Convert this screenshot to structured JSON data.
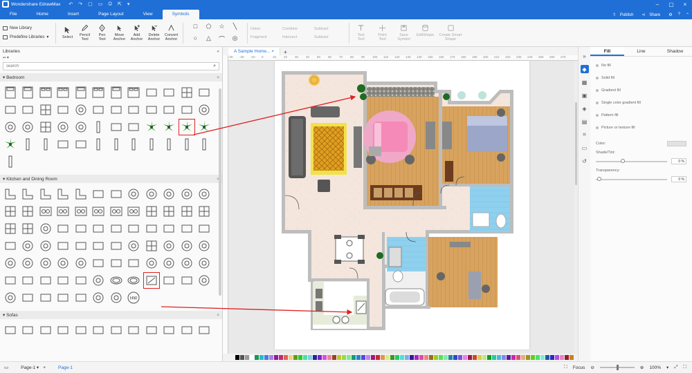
{
  "app": {
    "title": "Wondershare EdrawMax"
  },
  "menu": {
    "tabs": [
      "File",
      "Home",
      "Insert",
      "Page Layout",
      "View",
      "Symbols"
    ],
    "active": "Symbols",
    "publish": "Publish",
    "share": "Share",
    "user_initial": "1"
  },
  "ribbon": {
    "new_library": "New Library",
    "predefine_libraries": "Predefine Libraries",
    "tools": [
      {
        "line1": "Select",
        "line2": ""
      },
      {
        "line1": "Pencil",
        "line2": "Tool"
      },
      {
        "line1": "Pen",
        "line2": "Tool"
      },
      {
        "line1": "Move",
        "line2": "Anchor"
      },
      {
        "line1": "Add",
        "line2": "Anchor"
      },
      {
        "line1": "Delete",
        "line2": "Anchor"
      },
      {
        "line1": "Convert",
        "line2": "Anchor"
      }
    ],
    "boolean_ops": [
      "Union",
      "Combine",
      "Subtract",
      "Fragment",
      "Intersect",
      "Subtract"
    ],
    "grey_tools": [
      {
        "line1": "Text",
        "line2": "Tool"
      },
      {
        "line1": "Point",
        "line2": "Tool"
      },
      {
        "line1": "Save",
        "line2": "Symbol"
      },
      {
        "line1": "EditShape",
        "line2": ""
      },
      {
        "line1": "Create Smart",
        "line2": "Shape"
      }
    ]
  },
  "libraries": {
    "title": "Libraries",
    "search_placeholder": "search",
    "sections": [
      "Bedroom",
      "Kitchen and Dining Room",
      "Sofas"
    ],
    "hw_label": "HW"
  },
  "canvas": {
    "doc_tab": "A Sample Home...",
    "ruler_ticks": [
      "-30",
      "-20",
      "-10",
      "0",
      "10",
      "20",
      "30",
      "40",
      "50",
      "60",
      "70",
      "80",
      "90",
      "100",
      "110",
      "120",
      "130",
      "140",
      "150",
      "160",
      "170",
      "180",
      "190",
      "200",
      "210",
      "220",
      "230",
      "240",
      "250",
      "260",
      "270"
    ]
  },
  "properties": {
    "tabs": [
      "Fill",
      "Line",
      "Shadow"
    ],
    "active_tab": "Fill",
    "fill_options": [
      "No fill",
      "Solid fill",
      "Gradient fill",
      "Single color gradient fill",
      "Pattern fill",
      "Picture or texture fill"
    ],
    "color_label": "Color:",
    "shade_label": "Shade/Tint:",
    "shade_value": "0 %",
    "transparency_label": "Transparency:",
    "transparency_value": "0 %"
  },
  "status": {
    "page_dropdown": "Page-1",
    "page_tab": "Page-1",
    "focus": "Focus",
    "zoom": "100%"
  },
  "colors": {
    "brand": "#1f6fd6",
    "highlight": "#e02020",
    "wood": "#d7a35e",
    "tile": "#f4e6dd",
    "water": "#8fd0ee"
  }
}
